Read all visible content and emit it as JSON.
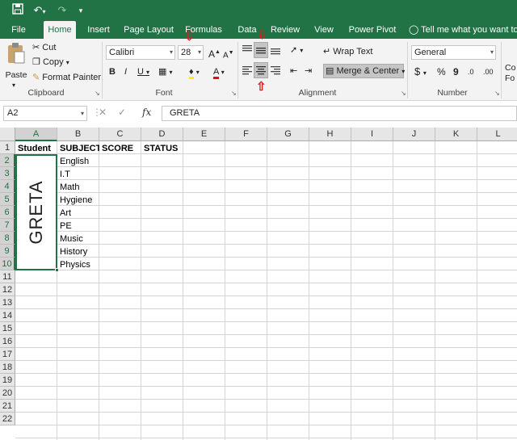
{
  "qat": {
    "save_icon": "save-icon",
    "undo_icon": "undo-icon",
    "redo_icon": "redo-icon",
    "customize_icon": "customize-icon"
  },
  "tabs": [
    {
      "label": "File"
    },
    {
      "label": "Home"
    },
    {
      "label": "Insert"
    },
    {
      "label": "Page Layout"
    },
    {
      "label": "Formulas"
    },
    {
      "label": "Data"
    },
    {
      "label": "Review"
    },
    {
      "label": "View"
    },
    {
      "label": "Power Pivot"
    }
  ],
  "tell_me": "Tell me what you want to d",
  "ribbon": {
    "clipboard": {
      "paste": "Paste",
      "cut": "Cut",
      "copy": "Copy",
      "format_painter": "Format Painter",
      "label": "Clipboard"
    },
    "font": {
      "name": "Calibri",
      "size": "28",
      "label": "Font",
      "bold": "B",
      "italic": "I",
      "underline": "U",
      "grow": "A",
      "shrink": "A"
    },
    "alignment": {
      "wrap_text": "Wrap Text",
      "merge_center": "Merge & Center",
      "label": "Alignment"
    },
    "number": {
      "format": "General",
      "currency": "$",
      "percent": "%",
      "comma": "9",
      "label": "Number"
    },
    "extra": {
      "top": "Co",
      "bottom": "Fo"
    }
  },
  "formula_bar": {
    "name_box": "A2",
    "value": "GRETA",
    "fx": "fx"
  },
  "columns": [
    "A",
    "B",
    "C",
    "D",
    "E",
    "F",
    "G",
    "H",
    "I",
    "J",
    "K",
    "L"
  ],
  "rows": [
    "1",
    "2",
    "3",
    "4",
    "5",
    "6",
    "7",
    "8",
    "9",
    "10",
    "11",
    "12",
    "13",
    "14",
    "15",
    "16",
    "17",
    "18",
    "19",
    "20",
    "21",
    "22"
  ],
  "sheet": {
    "headers": [
      "Student",
      "SUBJECT",
      "SCORE",
      "STATUS"
    ],
    "merged_value": "GRETA",
    "subjects": [
      "English",
      "I.T",
      "Math",
      "Hygiene",
      "Art",
      "PE",
      "Music",
      "History",
      "Physics"
    ]
  },
  "colors": {
    "accent": "#217346",
    "marker": "#d62020"
  }
}
